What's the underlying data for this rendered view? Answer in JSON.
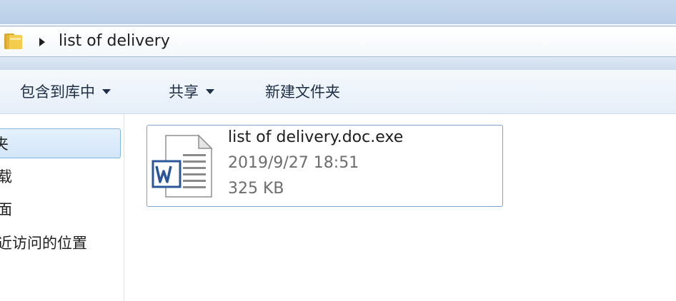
{
  "address": {
    "path": "list of delivery",
    "folder_icon": "folder-icon",
    "arrow_icon": "chevron-right-icon"
  },
  "toolbar": {
    "include_in_library": "包含到库中",
    "share": "共享",
    "new_folder": "新建文件夹"
  },
  "nav": {
    "items": [
      {
        "label": "夹",
        "selected": true
      },
      {
        "label": "载"
      },
      {
        "label": "面"
      },
      {
        "label": "近访问的位置"
      }
    ]
  },
  "file": {
    "name": "list of delivery.doc.exe",
    "date": "2019/9/27 18:51",
    "size": "325 KB",
    "icon": "word-document-icon"
  },
  "colors": {
    "selection_border": "#7da2ce",
    "word_blue": "#2b579a",
    "meta_text": "#6d6d6d"
  }
}
